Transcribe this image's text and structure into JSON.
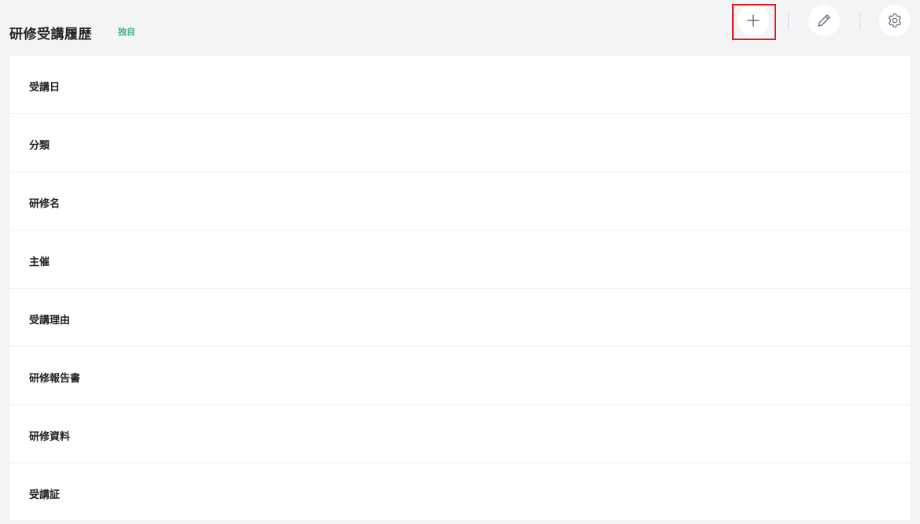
{
  "header": {
    "title": "研修受講履歴",
    "badge": "独自",
    "actions": [
      {
        "name": "add",
        "icon": "plus-icon",
        "highlighted": true
      },
      {
        "name": "edit",
        "icon": "pencil-icon"
      },
      {
        "name": "settings",
        "icon": "gear-icon"
      }
    ]
  },
  "fields": [
    {
      "label": "受講日"
    },
    {
      "label": "分類"
    },
    {
      "label": "研修名"
    },
    {
      "label": "主催"
    },
    {
      "label": "受講理由"
    },
    {
      "label": "研修報告書"
    },
    {
      "label": "研修資料"
    },
    {
      "label": "受講証"
    }
  ],
  "colors": {
    "background": "#f3f4f6",
    "card": "#ffffff",
    "badge": "#3cb87a",
    "highlight": "#e01b1b",
    "icon": "#6b7280"
  }
}
